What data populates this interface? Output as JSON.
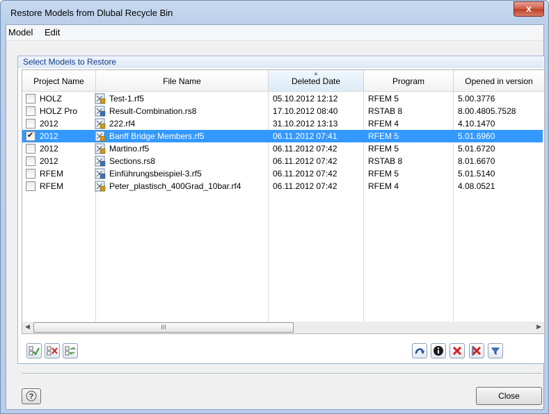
{
  "window": {
    "title": "Restore Models from Dlubal Recycle Bin",
    "close_glyph": "x"
  },
  "menu": {
    "items": [
      "Model",
      "Edit"
    ]
  },
  "group": {
    "title": "Select Models to Restore"
  },
  "table": {
    "columns": [
      "Project Name",
      "File Name",
      "Deleted Date",
      "Program",
      "Opened in version"
    ],
    "sorted_column": "Deleted Date",
    "rows": [
      {
        "checked": false,
        "selected": false,
        "project": "HOLZ",
        "file": "Test-1.rf5",
        "date": "05.10.2012 12:12",
        "program": "RFEM 5",
        "version": "5.00.3776",
        "icon": "rfem-file-icon"
      },
      {
        "checked": false,
        "selected": false,
        "project": "HOLZ Pro",
        "file": "Result-Combination.rs8",
        "date": "17.10.2012 08:40",
        "program": "RSTAB 8",
        "version": "8.00.4805.7528",
        "icon": "rstab-file-icon"
      },
      {
        "checked": false,
        "selected": false,
        "project": "2012",
        "file": "222.rf4",
        "date": "31.10.2012 13:13",
        "program": "RFEM 4",
        "version": "4.10.1470",
        "icon": "rfem-file-icon"
      },
      {
        "checked": true,
        "selected": true,
        "project": "2012",
        "file": "Banff Bridge Members.rf5",
        "date": "06.11.2012 07:41",
        "program": "RFEM 5",
        "version": "5.01.6960",
        "icon": "rfem-file-icon"
      },
      {
        "checked": false,
        "selected": false,
        "project": "2012",
        "file": "Martino.rf5",
        "date": "06.11.2012 07:42",
        "program": "RFEM 5",
        "version": "5.01.6720",
        "icon": "rfem-file-icon"
      },
      {
        "checked": false,
        "selected": false,
        "project": "2012",
        "file": "Sections.rs8",
        "date": "06.11.2012 07:42",
        "program": "RSTAB 8",
        "version": "8.01.6670",
        "icon": "rstab-file-icon"
      },
      {
        "checked": false,
        "selected": false,
        "project": "RFEM",
        "file": "Einführungsbeispiel-3.rf5",
        "date": "06.11.2012 07:42",
        "program": "RFEM 5",
        "version": "5.01.5140",
        "icon": "rstab-file-icon"
      },
      {
        "checked": false,
        "selected": false,
        "project": "RFEM",
        "file": "Peter_plastisch_400Grad_10bar.rf4",
        "date": "06.11.2012 07:42",
        "program": "RFEM 4",
        "version": "4.08.0521",
        "icon": "rfem-file-icon"
      }
    ]
  },
  "scrollbar": {
    "thumb_grip": "III",
    "left_arrow": "◀",
    "right_arrow": "▶"
  },
  "toolbar_left": [
    "check-all-icon",
    "uncheck-all-icon",
    "invert-selection-icon"
  ],
  "toolbar_right": [
    "restore-icon",
    "info-icon",
    "delete-icon",
    "delete-all-icon",
    "filter-icon"
  ],
  "footer": {
    "close_label": "Close",
    "help_icon": "help-icon"
  },
  "colors": {
    "selection": "#3399ff",
    "group_title_text": "#10398a",
    "delete_red": "#d42020",
    "check_green": "#2e9a2e"
  }
}
